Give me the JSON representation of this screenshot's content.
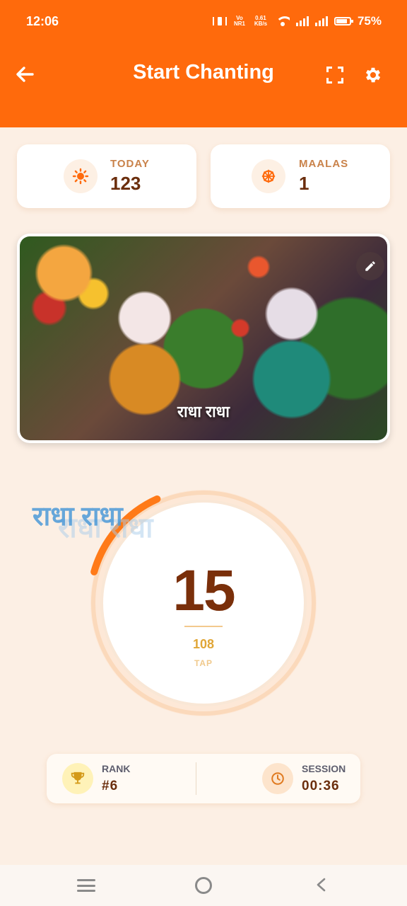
{
  "status_bar": {
    "time": "12:06",
    "volte": "Vo NR1",
    "speed": "0.61 KB/s",
    "battery": "75%"
  },
  "app_bar": {
    "title": "Start Chanting",
    "icons": [
      "back-arrow-icon",
      "fullscreen-icon",
      "gear-icon"
    ]
  },
  "stats": {
    "today": {
      "label": "TODAY",
      "value": "123",
      "icon": "sun-icon"
    },
    "maalas": {
      "label": "MAALAS",
      "value": "1",
      "icon": "wheel-icon"
    }
  },
  "image_card": {
    "caption": "राधा राधा",
    "icon": "pencil-icon"
  },
  "counter": {
    "floating_text": "राधा राधा",
    "count": "15",
    "target": "108",
    "progress_fraction": 0.139,
    "tap_label": "TAP"
  },
  "bottom_stats": {
    "rank": {
      "label": "RANK",
      "value": "#6",
      "icon": "trophy-icon"
    },
    "session": {
      "label": "SESSION",
      "value": "00:36",
      "icon": "clock-icon"
    }
  },
  "colors": {
    "primary": "#ff6a0c",
    "background": "#fcefe4",
    "counter_text": "#7a2f0a",
    "target_text": "#e0a637"
  },
  "nav_bar": {
    "icons": [
      "menu-icon",
      "home-icon",
      "back-icon"
    ]
  }
}
